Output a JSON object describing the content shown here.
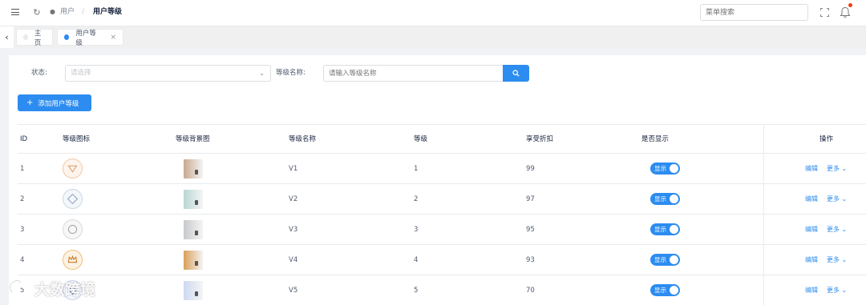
{
  "header": {
    "breadcrumb": {
      "parent": "用户",
      "separator": "/",
      "current": "用户等级"
    },
    "menu_search": {
      "placeholder": "菜单搜索"
    }
  },
  "tabs": {
    "home": "主页",
    "level": "用户等级",
    "close": "×"
  },
  "filter": {
    "status_label": "状态:",
    "status_placeholder": "请选择",
    "name_label": "等级名称:",
    "name_placeholder": "请输入等级名称"
  },
  "actions": {
    "add_label": "添加用户等级"
  },
  "table": {
    "columns": [
      "ID",
      "等级图标",
      "等级背景图",
      "等级名称",
      "等级",
      "享受折扣",
      "是否显示",
      "操作"
    ],
    "rows": [
      {
        "id": "1",
        "name": "V1",
        "level": "1",
        "discount": "99",
        "show": "显示",
        "badge_color": "#f5c9a3",
        "thumb_color": "#c9a88e"
      },
      {
        "id": "2",
        "name": "V2",
        "level": "2",
        "discount": "97",
        "show": "显示",
        "badge_color": "#c7d7e6",
        "thumb_color": "#b7d7d4"
      },
      {
        "id": "3",
        "name": "V3",
        "level": "3",
        "discount": "95",
        "show": "显示",
        "badge_color": "#d9d9d9",
        "thumb_color": "#c7c9cc"
      },
      {
        "id": "4",
        "name": "V4",
        "level": "4",
        "discount": "93",
        "show": "显示",
        "badge_color": "#f2c07a",
        "thumb_color": "#d9a05a"
      },
      {
        "id": "5",
        "name": "V5",
        "level": "5",
        "discount": "70",
        "show": "显示",
        "badge_color": "#c8d4f0",
        "thumb_color": "#cdd9f2"
      }
    ],
    "edit_label": "编辑",
    "more_label": "更多 ⌄"
  },
  "watermark": {
    "text": "大数跨境"
  },
  "colors": {
    "primary": "#2d8cf0",
    "notification": "#ed4014"
  }
}
